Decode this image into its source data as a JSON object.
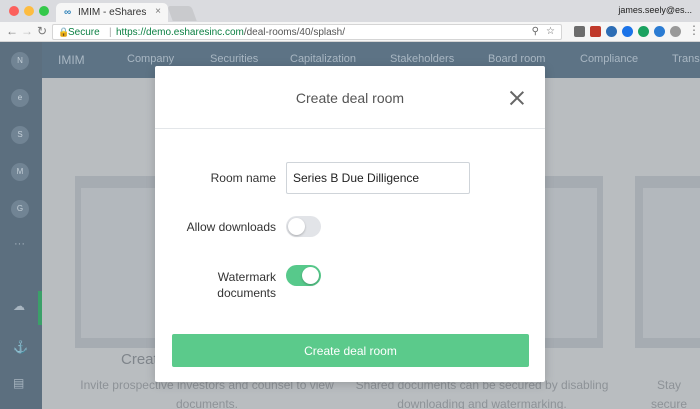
{
  "browser": {
    "tab_title": "IMIM - eShares",
    "tab_close": "×",
    "user": "james.seely@es...",
    "address": {
      "secure_label": "Secure",
      "separator": "|",
      "url_host": "https://demo.esharesinc.com",
      "url_path": "/deal-rooms/40/splash/"
    }
  },
  "app": {
    "brand": "IMIM",
    "nav": [
      "Company",
      "Securities",
      "Capitalization",
      "Stakeholders",
      "Board room",
      "Compliance",
      "Transa"
    ],
    "sidebar_initials": [
      "N",
      "e",
      "S",
      "M",
      "G"
    ],
    "sidebar_more": "···",
    "background": {
      "heading_left": "Create",
      "text_left": "Invite prospective investors and counsel to view documents.",
      "text_mid": "Shared documents can be secured by disabling downloading and watermarking.",
      "text_right": "Stay secure viewers"
    }
  },
  "modal": {
    "title": "Create deal room",
    "room_name_label": "Room name",
    "room_name_value": "Series B Due Dilligence",
    "allow_downloads_label": "Allow downloads",
    "allow_downloads": false,
    "watermark_label_line1": "Watermark",
    "watermark_label_line2": "documents",
    "watermark": true,
    "submit_label": "Create deal room"
  },
  "colors": {
    "accent": "#5bca8b",
    "toggle_on": "#57c98b",
    "toggle_off": "#e2e4e8",
    "sidebar": "#5c6f7f",
    "topnav": "#5d7385"
  }
}
